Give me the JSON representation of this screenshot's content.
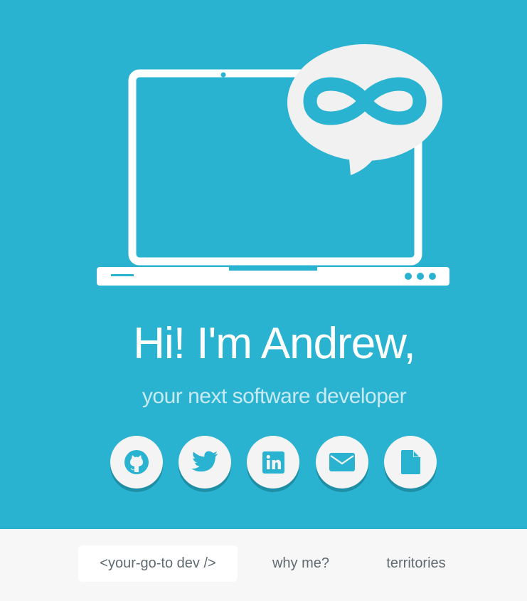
{
  "hero": {
    "greeting": "Hi! I'm Andrew,",
    "tagline": "your next software developer"
  },
  "colors": {
    "hero_bg": "#2ab3d0",
    "button_bg": "#f4f4f4",
    "button_shadow": "#1e8ea6",
    "icon": "#2ab3d0",
    "nav_bg": "#f7f7f7",
    "nav_text": "#5f6b70"
  },
  "social": [
    {
      "icon": "github-icon"
    },
    {
      "icon": "twitter-icon"
    },
    {
      "icon": "linkedin-icon"
    },
    {
      "icon": "email-icon"
    },
    {
      "icon": "resume-document-icon"
    }
  ],
  "nav": {
    "items": [
      {
        "label": "<your-go-to dev />",
        "active": true
      },
      {
        "label": "why me?",
        "active": false
      },
      {
        "label": "territories",
        "active": false
      }
    ]
  }
}
